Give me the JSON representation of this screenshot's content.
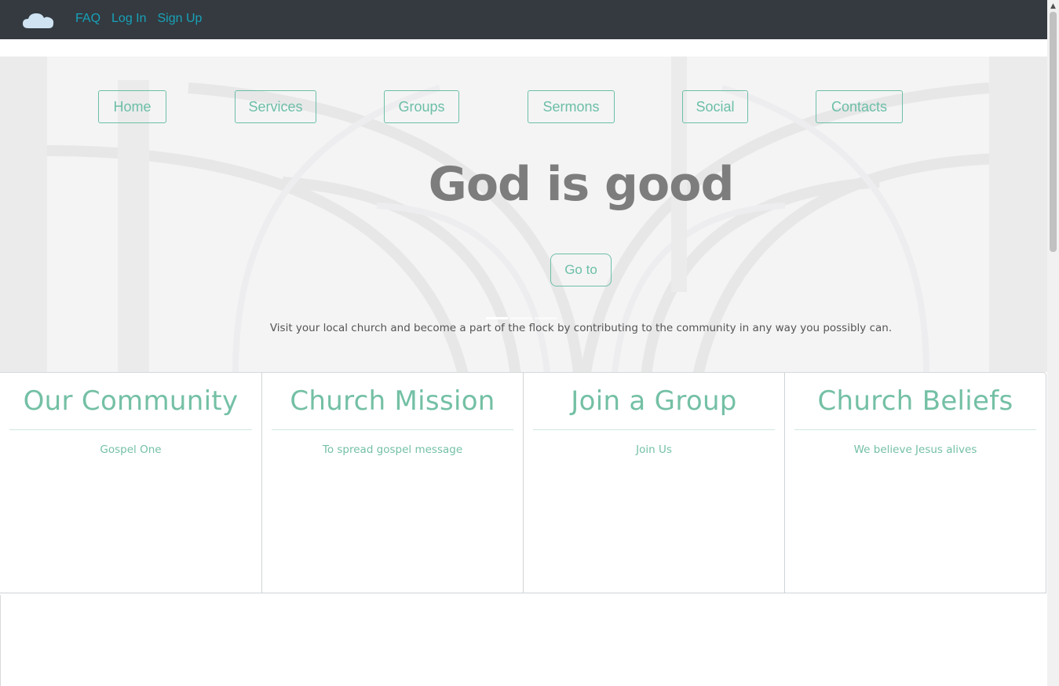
{
  "topbar": {
    "logo_icon": "cloud-icon",
    "links": [
      "FAQ",
      "Log In",
      "Sign Up"
    ]
  },
  "hero": {
    "nav": [
      "Home",
      "Services",
      "Groups",
      "Sermons",
      "Social",
      "Contacts"
    ],
    "title": "God is good",
    "button_label": "Go to",
    "caption": "Visit your local church and become a part of the flock by contributing to the community in any way you possibly can.",
    "active_slide": 1,
    "slide_count": 3
  },
  "cards": [
    {
      "title": "Our Community",
      "text": "Gospel One"
    },
    {
      "title": "Church Mission",
      "text": "To spread gospel message"
    },
    {
      "title": "Join a Group",
      "text": "Join Us"
    },
    {
      "title": "Church Beliefs",
      "text": "We believe Jesus alives"
    }
  ],
  "colors": {
    "navbar": "#343a40",
    "link": "#17a2b8",
    "accent": "#74c0a5",
    "hero_title": "#7d7d7d"
  },
  "scrollbar": {
    "up_icon": "scroll-up-arrow-icon"
  }
}
